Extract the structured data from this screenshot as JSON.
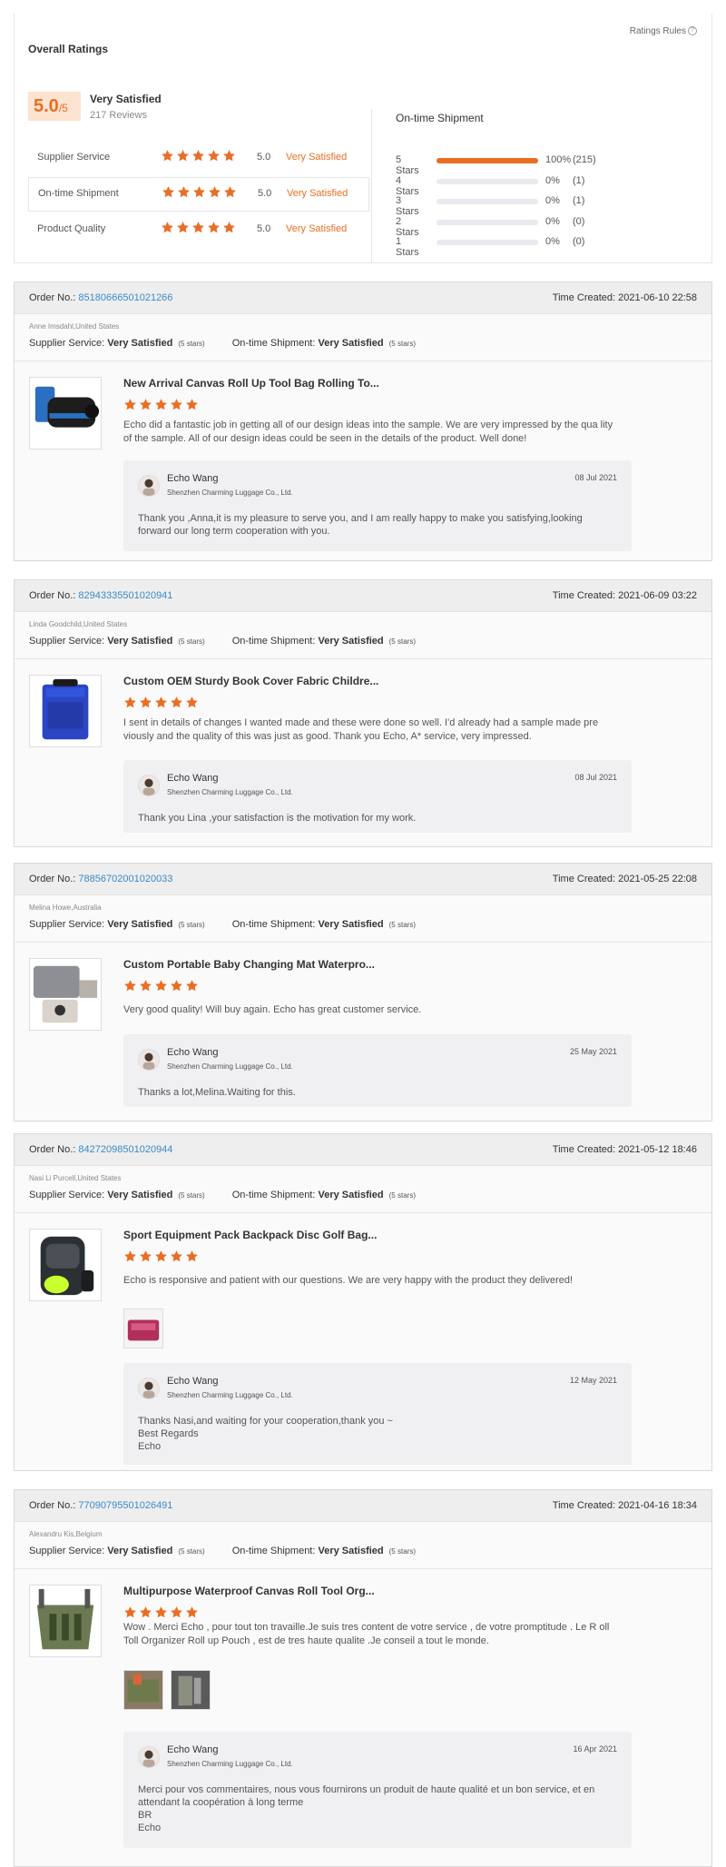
{
  "ratings_rules": "Ratings Rules",
  "overall": {
    "title": "Overall Ratings",
    "score": "5.0",
    "score_max": "/5",
    "summary": "Very Satisfied",
    "reviews": "217 Reviews",
    "rows": [
      {
        "label": "Supplier Service",
        "score": "5.0",
        "text": "Very Satisfied",
        "stars": 5
      },
      {
        "label": "On-time Shipment",
        "score": "5.0",
        "text": "Very Satisfied",
        "stars": 5
      },
      {
        "label": "Product Quality",
        "score": "5.0",
        "text": "Very Satisfied",
        "stars": 5
      }
    ]
  },
  "shipment": {
    "title": "On-time Shipment",
    "bars": [
      {
        "label": "5 Stars",
        "fraction": 1.0,
        "percent": "100%",
        "count": "(215)"
      },
      {
        "label": "4 Stars",
        "fraction": 0.0,
        "percent": "0%",
        "count": "(1)"
      },
      {
        "label": "3 Stars",
        "fraction": 0.0,
        "percent": "0%",
        "count": "(1)"
      },
      {
        "label": "2 Stars",
        "fraction": 0.0,
        "percent": "0%",
        "count": "(0)"
      },
      {
        "label": "1 Stars",
        "fraction": 0.0,
        "percent": "0%",
        "count": "(0)"
      }
    ]
  },
  "colors": {
    "accent": "#e96e24",
    "link": "#3c8ac9",
    "header_bg": "#eeeeee"
  },
  "labels": {
    "order_no": "Order No.:",
    "time_created": "Time Created:",
    "supplier_service": "Supplier Service:",
    "on_time_shipment": "On-time Shipment:",
    "very_satisfied": "Very Satisfied",
    "five_stars": "(5 stars)"
  },
  "reviews": [
    {
      "order_no": "85180666501021266",
      "time": "2021-06-10 22:58",
      "buyer": "Anne Imsdahl,United States",
      "product": "New Arrival Canvas Roll Up Tool Bag Rolling To...",
      "comment": "Echo did a fantastic job in getting all of our design ideas into the sample. We are very impressed by the qua lity of the sample. All of our design ideas could be seen in the details of the product. Well done!",
      "reply": {
        "name": "Echo Wang",
        "company": "Shenzhen Charming Luggage Co., Ltd.",
        "date": "08 Jul 2021",
        "text": "Thank you ,Anna,it is my pleasure to serve you, and I am really happy to make you satisfying,looking forward our long term cooperation with you."
      }
    },
    {
      "order_no": "82943335501020941",
      "time": "2021-06-09 03:22",
      "buyer": "Linda Goodchild,United States",
      "product": "Custom OEM Sturdy Book Cover Fabric Childre...",
      "comment": "I sent in details of changes I wanted made and these were done so well.  I'd already had a sample made pre viously and the quality of this was just as good.  Thank you Echo, A* service, very impressed.",
      "reply": {
        "name": "Echo Wang",
        "company": "Shenzhen Charming Luggage Co., Ltd.",
        "date": "08 Jul 2021",
        "text": "Thank you Lina ,your satisfaction is the motivation for my work."
      }
    },
    {
      "order_no": "78856702001020033",
      "time": "2021-05-25 22:08",
      "buyer": "Melina Howe,Australia",
      "product": "Custom Portable Baby Changing Mat Waterpro...",
      "comment": "Very good quality! Will buy again. Echo has great customer service.",
      "reply": {
        "name": "Echo Wang",
        "company": "Shenzhen Charming Luggage Co., Ltd.",
        "date": "25 May 2021",
        "text": "Thanks  a lot,Melina.Waiting for this."
      }
    },
    {
      "order_no": "84272098501020944",
      "time": "2021-05-12 18:46",
      "buyer": "Nasi Li Purcell,United States",
      "product": "Sport Equipment Pack Backpack Disc Golf Bag...",
      "comment": "Echo is responsive and patient with our questions. We are very happy with the product they delivered!",
      "reply": {
        "name": "Echo Wang",
        "company": "Shenzhen Charming Luggage Co., Ltd.",
        "date": "12 May 2021",
        "text": "Thanks Nasi,and waiting for your cooperation,thank you ~\nBest Regards\nEcho"
      }
    },
    {
      "order_no": "77090795501026491",
      "time": "2021-04-16 18:34",
      "buyer": "Alexandru Kis,Belgium",
      "product": "Multipurpose Waterproof Canvas Roll Tool Org...",
      "comment": "Wow . Merci Echo , pour tout ton travaille.Je suis tres content de votre service , de votre promptitude . Le R oll Toll Organizer Roll up Pouch , est de tres haute qualite .Je conseil a tout le monde.",
      "reply": {
        "name": "Echo Wang",
        "company": "Shenzhen Charming Luggage Co., Ltd.",
        "date": "16 Apr 2021",
        "text": "Merci pour vos commentaires, nous vous fournirons un produit de haute qualité et un bon service, et en attendant la coopération à long terme\nBR\nEcho"
      }
    }
  ]
}
